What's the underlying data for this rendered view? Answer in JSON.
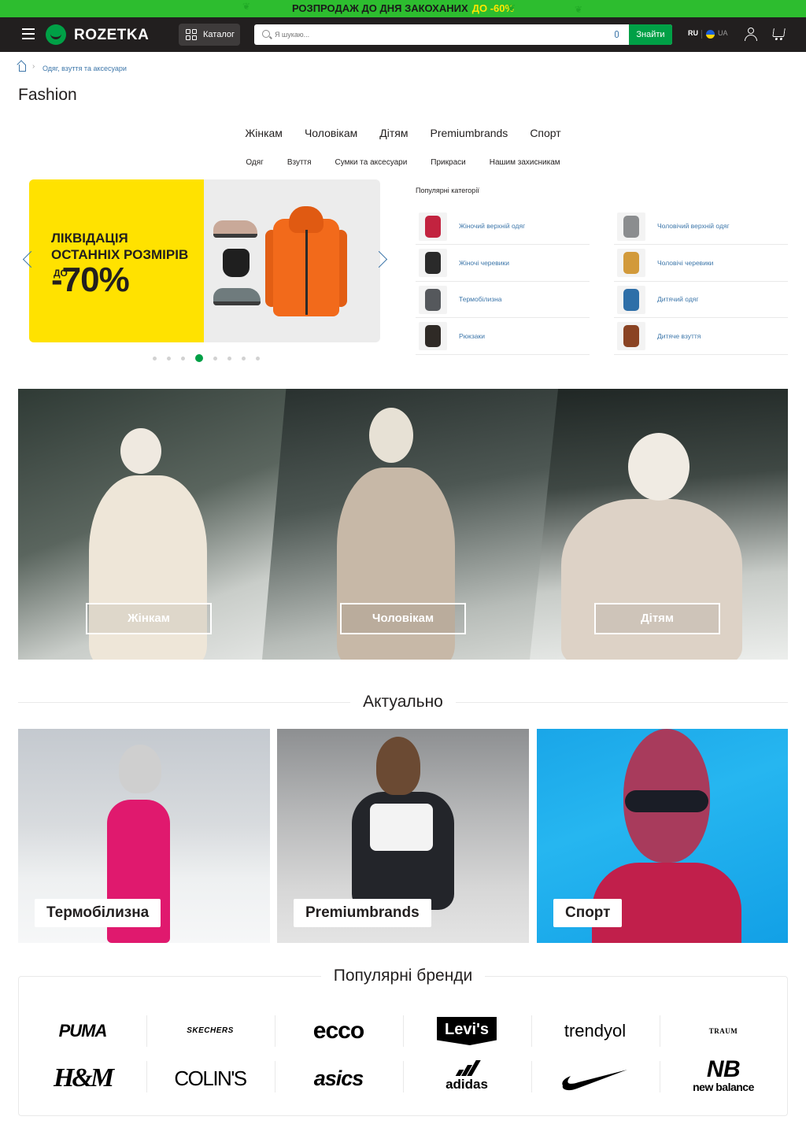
{
  "promo": {
    "text": "РОЗПРОДАЖ ДО ДНЯ ЗАКОХАНИХ",
    "highlight": "ДО -60%"
  },
  "header": {
    "logo": "ROZETKA",
    "catalog_label": "Каталог",
    "search_placeholder": "Я шукаю...",
    "search_button": "Знайти",
    "lang_ru": "RU",
    "lang_ua": "UA"
  },
  "breadcrumb": {
    "item": "Одяг, взуття та аксесуари"
  },
  "page_title": "Fashion",
  "main_tabs": [
    "Жінкам",
    "Чоловікам",
    "Дітям",
    "Premiumbrands",
    "Спорт"
  ],
  "sub_tabs": [
    "Одяг",
    "Взуття",
    "Сумки та аксесуари",
    "Прикраси",
    "Нашим захисникам"
  ],
  "banner": {
    "line1": "ЛІКВІДАЦІЯ",
    "line2": "ОСТАННІХ РОЗМІРІВ",
    "prefix": "ДО",
    "discount": "-70%"
  },
  "carousel": {
    "total": 8,
    "active_index": 3
  },
  "popular": {
    "title": "Популярні категорії",
    "items": [
      {
        "label": "Жіночий верхній одяг",
        "color": "#c2233f"
      },
      {
        "label": "Чоловічий верхній одяг",
        "color": "#8b8d8f"
      },
      {
        "label": "Жіночі черевики",
        "color": "#2a2a2a"
      },
      {
        "label": "Чоловічі черевики",
        "color": "#d29a3b"
      },
      {
        "label": "Термобілизна",
        "color": "#55585c"
      },
      {
        "label": "Дитячий одяг",
        "color": "#2e6fa8"
      },
      {
        "label": "Рюкзаки",
        "color": "#2f2a26"
      },
      {
        "label": "Дитяче взуття",
        "color": "#8a4323"
      }
    ]
  },
  "hero": {
    "buttons": [
      "Жінкам",
      "Чоловікам",
      "Дітям"
    ]
  },
  "actual": {
    "title": "Актуально",
    "tiles": [
      "Термобілизна",
      "Premiumbrands",
      "Спорт"
    ]
  },
  "brands": {
    "title": "Популярні бренди",
    "items": [
      "PUMA",
      "SKECHERS",
      "ecco",
      "Levi's",
      "trendyol",
      "TRAUM",
      "H&M",
      "COLIN'S",
      "asics",
      "adidas",
      "nike",
      "new balance"
    ]
  }
}
